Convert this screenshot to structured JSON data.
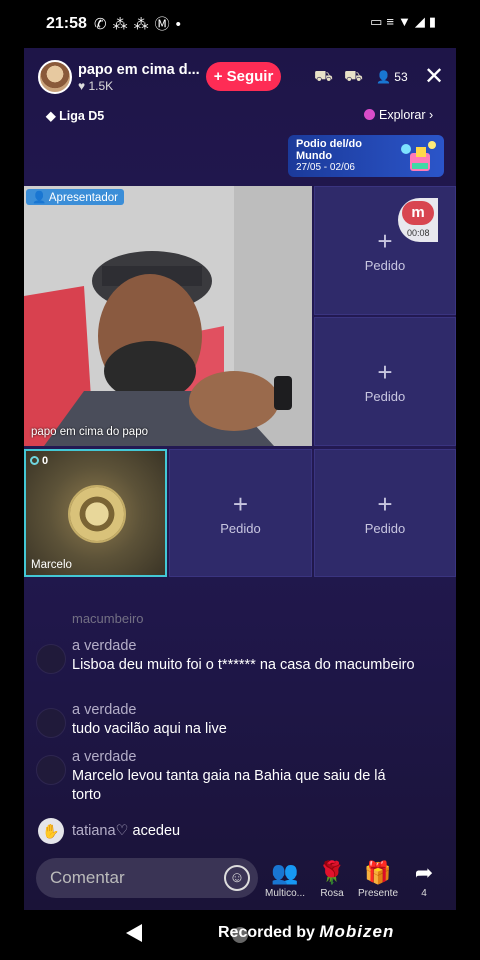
{
  "status_bar": {
    "time": "21:58",
    "left_icons": [
      "whatsapp-icon",
      "app-icon",
      "app-icon",
      "mobizen-icon",
      "dot-icon"
    ],
    "right_icons": [
      "cast-icon",
      "volte-icon",
      "wifi-icon",
      "signal-icon",
      "battery-icon"
    ]
  },
  "header": {
    "host_name": "papo em cima d...",
    "likes": "♥ 1.5K",
    "follow_label": "+ Seguir",
    "viewers": "53",
    "close_label": "✕"
  },
  "league": {
    "label": "Liga D5"
  },
  "explore": {
    "label": "Explorar",
    "chevron": "›"
  },
  "banner": {
    "title": "Podio del/do Mundo",
    "dates": "27/05 - 02/06"
  },
  "host_video": {
    "role_label": "Apresentador",
    "name_overlay": "papo em cima do papo"
  },
  "recorder": {
    "logo": "m",
    "elapsed": "00:08"
  },
  "guest_tile": {
    "count": "0",
    "name": "Marcelo"
  },
  "empty_slot_label": "Pedido",
  "chat": {
    "cut_line": "macumbeiro",
    "messages": [
      {
        "user": "a verdade",
        "text": "Lisboa deu muito foi o t****** na casa do macumbeiro"
      },
      {
        "user": "a verdade",
        "text": "tudo vacilão aqui na live"
      },
      {
        "user": "a verdade",
        "text": "Marcelo levou tanta gaia na Bahia que saiu de lá torto"
      }
    ],
    "join_event": {
      "user": "tatiana♡",
      "action": "acedeu"
    }
  },
  "bottom_bar": {
    "comment_placeholder": "Comentar",
    "actions": [
      {
        "label": "Multico...",
        "icon": "multiguest-icon"
      },
      {
        "label": "Rosa",
        "icon": "rose-icon"
      },
      {
        "label": "Presente",
        "icon": "gift-icon"
      },
      {
        "label": "4",
        "icon": "share-icon"
      }
    ]
  },
  "nav_bar": {
    "recorded_prefix": "Recorded by",
    "recorded_brand": "Mobizen"
  }
}
